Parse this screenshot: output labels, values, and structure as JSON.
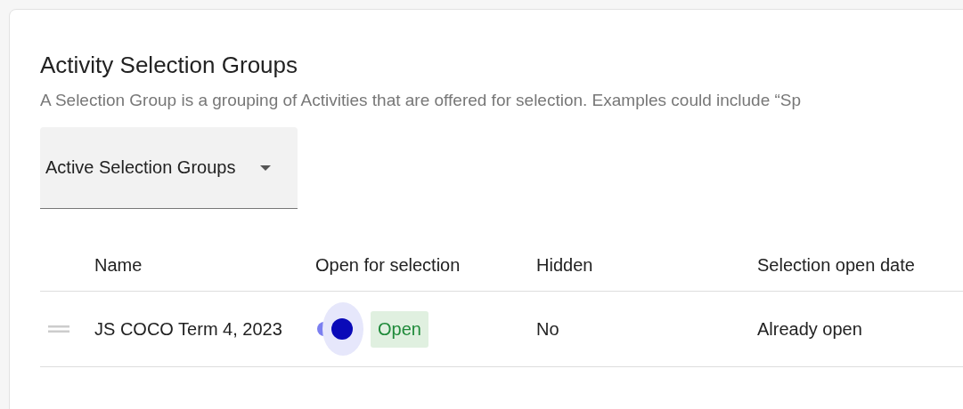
{
  "title": "Activity Selection Groups",
  "description": "A Selection Group is a grouping of Activities that are offered for selection. Examples could include “Sp",
  "filter": {
    "value": "Active Selection Groups"
  },
  "table": {
    "columns": [
      "Name",
      "Open for selection",
      "Hidden",
      "Selection open date"
    ],
    "rows": [
      {
        "name": "JS COCO Term 4, 2023",
        "open": true,
        "status": "Open",
        "hidden": "No",
        "open_date": "Already open"
      }
    ]
  }
}
